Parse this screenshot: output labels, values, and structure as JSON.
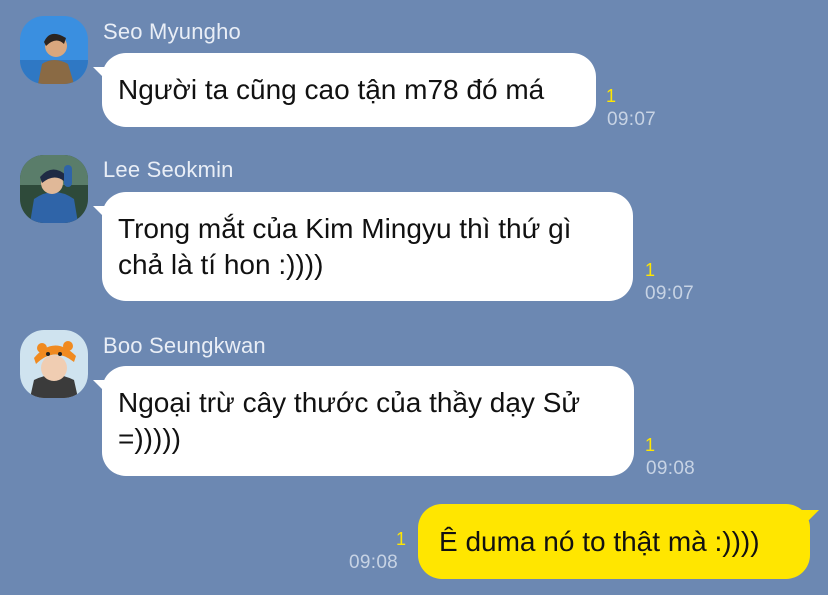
{
  "messages": [
    {
      "sender": "Seo Myungho",
      "lines": [
        "Người ta cũng cao tận m78 đó má"
      ],
      "unread": "1",
      "time": "09:07"
    },
    {
      "sender": "Lee Seokmin",
      "lines": [
        "Trong mắt của Kim Mingyu thì thứ gì",
        "chả là tí hon :))))"
      ],
      "unread": "1",
      "time": "09:07"
    },
    {
      "sender": "Boo Seungkwan",
      "lines": [
        "Ngoại trừ cây thước của thầy dạy Sử",
        "=)))))"
      ],
      "unread": "1",
      "time": "09:08"
    },
    {
      "lines": [
        "Ê duma nó to thật mà :))))"
      ],
      "unread": "1",
      "time": "09:08"
    }
  ],
  "colors": {
    "background": "#6c88b2",
    "incoming_bubble": "#ffffff",
    "outgoing_bubble": "#ffe600",
    "unread_count": "#ffe600",
    "timestamp": "#c7d3e4"
  },
  "icons": [
    "avatar-photo-seo-myungho",
    "avatar-photo-lee-seokmin",
    "avatar-photo-boo-seungkwan"
  ]
}
